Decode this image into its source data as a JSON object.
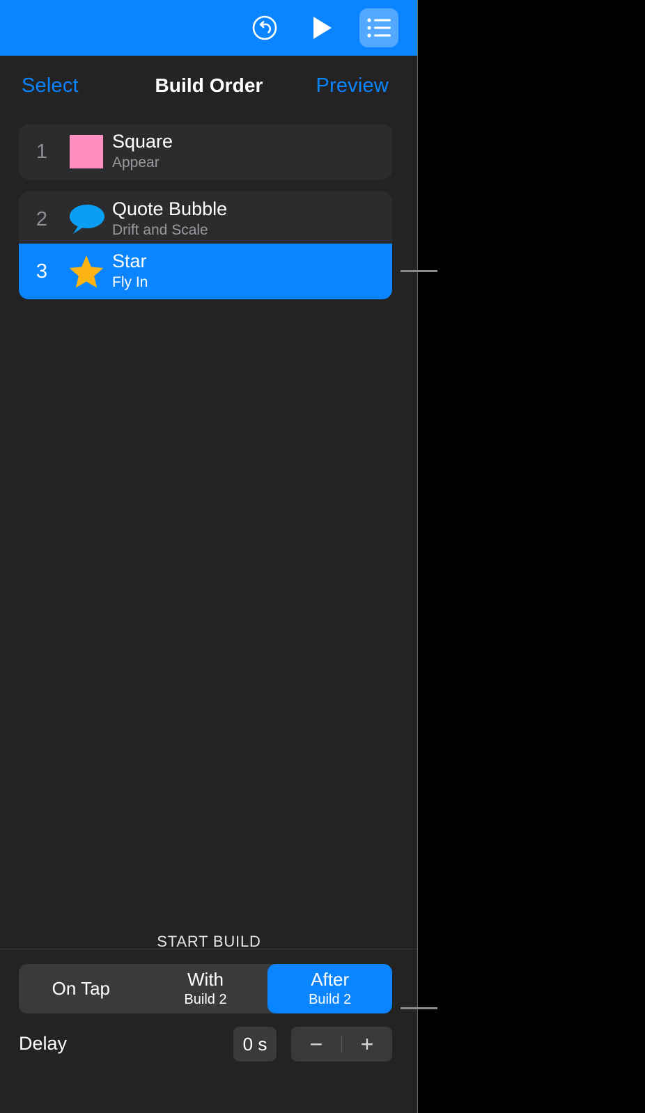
{
  "toolbar": {
    "undo_icon": "undo-circle-icon",
    "play_icon": "play-icon",
    "list_icon": "bulleted-list-icon"
  },
  "nav": {
    "left_label": "Select",
    "title": "Build Order",
    "right_label": "Preview"
  },
  "builds": [
    {
      "index": "1",
      "title": "Square",
      "effect": "Appear",
      "icon": "pink-square-icon",
      "selected": false
    },
    {
      "index": "2",
      "title": "Quote Bubble",
      "effect": "Drift and Scale",
      "icon": "quote-bubble-icon",
      "selected": false
    },
    {
      "index": "3",
      "title": "Star",
      "effect": "Fly In",
      "icon": "star-icon",
      "selected": true
    }
  ],
  "start_build": {
    "section_label": "START BUILD",
    "segments": [
      {
        "main": "On Tap",
        "sub": "",
        "selected": false
      },
      {
        "main": "With",
        "sub": "Build 2",
        "selected": false
      },
      {
        "main": "After",
        "sub": "Build 2",
        "selected": true
      }
    ]
  },
  "delay": {
    "label": "Delay",
    "value": "0 s",
    "decrement_label": "−",
    "increment_label": "+"
  },
  "colors": {
    "accent_blue": "#0a84ff",
    "panel_bg": "#232323",
    "row_bg": "#2c2c2e",
    "square_pink": "#ff8ec0",
    "star_orange": "#fcb316",
    "bubble_blue": "#0a9ff5",
    "secondary_text": "#8e8e93"
  }
}
